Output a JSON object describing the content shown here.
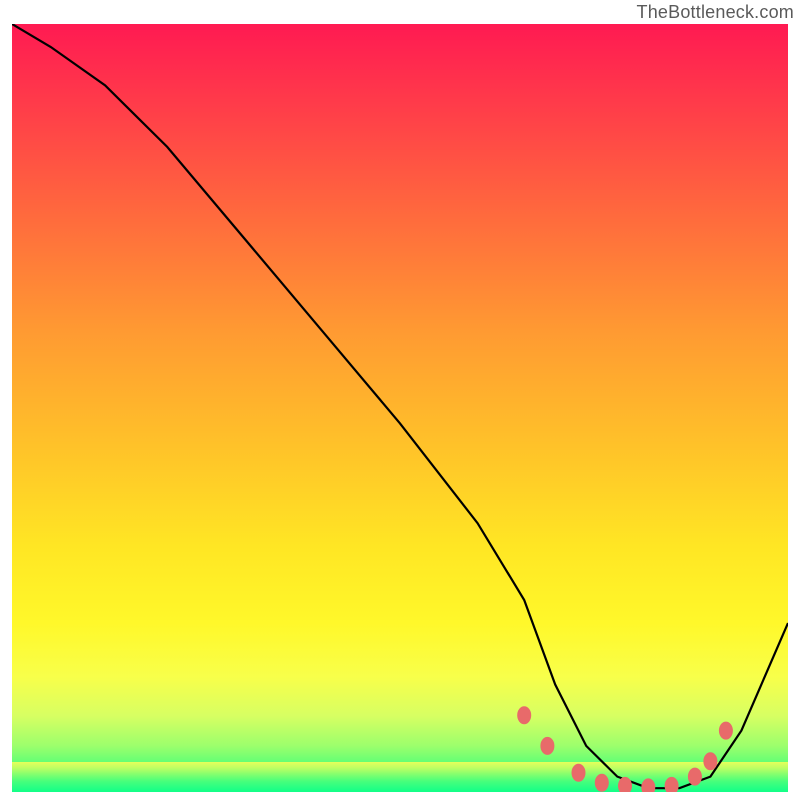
{
  "attribution": "TheBottleneck.com",
  "chart_data": {
    "type": "line",
    "title": "",
    "xlabel": "",
    "ylabel": "",
    "xlim": [
      0,
      100
    ],
    "ylim": [
      0,
      100
    ],
    "series": [
      {
        "name": "bottleneck-curve",
        "x": [
          0,
          5,
          12,
          20,
          30,
          40,
          50,
          60,
          66,
          70,
          74,
          78,
          82,
          86,
          90,
          94,
          100
        ],
        "y": [
          100,
          97,
          92,
          84,
          72,
          60,
          48,
          35,
          25,
          14,
          6,
          2,
          0.5,
          0.5,
          2,
          8,
          22
        ]
      }
    ],
    "markers": {
      "name": "highlight-dots",
      "x": [
        66,
        69,
        73,
        76,
        79,
        82,
        85,
        88,
        90,
        92
      ],
      "y": [
        10,
        6,
        2.5,
        1.2,
        0.8,
        0.6,
        0.8,
        2,
        4,
        8
      ]
    }
  },
  "colors": {
    "curve": "#000000",
    "marker": "#e86a6a"
  }
}
